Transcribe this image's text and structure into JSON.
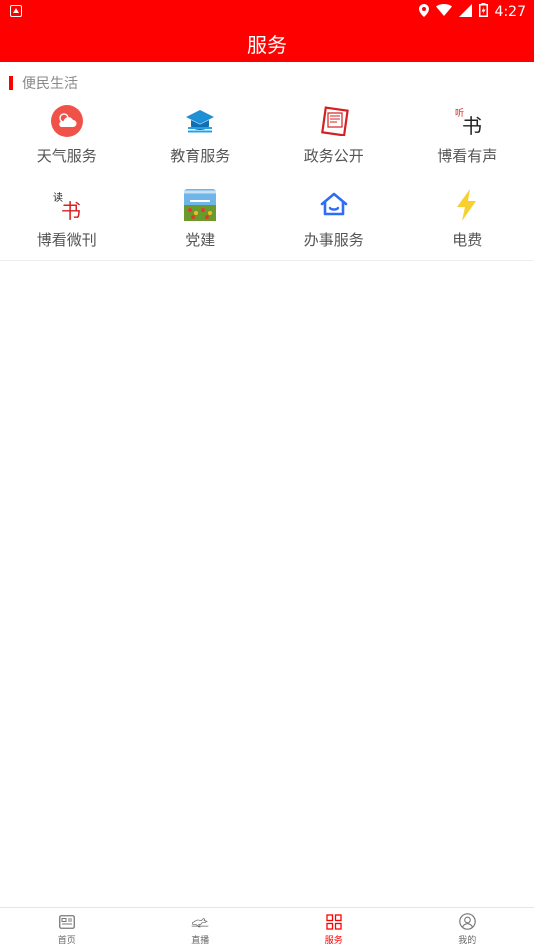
{
  "status_bar": {
    "time": "4:27"
  },
  "header": {
    "title": "服务"
  },
  "section": {
    "title": "便民生活"
  },
  "services": [
    {
      "label": "天气服务",
      "icon": "weather-cloud-icon"
    },
    {
      "label": "教育服务",
      "icon": "graduation-cap-icon"
    },
    {
      "label": "政务公开",
      "icon": "government-document-icon"
    },
    {
      "label": "博看有声",
      "icon": "listen-book-icon"
    },
    {
      "label": "博看微刊",
      "icon": "read-book-icon"
    },
    {
      "label": "党建",
      "icon": "party-building-photo-icon"
    },
    {
      "label": "办事服务",
      "icon": "house-icon"
    },
    {
      "label": "电费",
      "icon": "lightning-icon"
    }
  ],
  "tabbar": {
    "items": [
      {
        "label": "首页",
        "icon": "news-icon"
      },
      {
        "label": "直播",
        "icon": "live-horse-icon"
      },
      {
        "label": "服务",
        "icon": "grid-icon"
      },
      {
        "label": "我的",
        "icon": "user-icon"
      }
    ],
    "active_index": 2
  },
  "colors": {
    "brand": "#ff0000",
    "text": "#555555",
    "muted": "#888888",
    "bolt": "#f7d02f",
    "house": "#2f6df5"
  }
}
